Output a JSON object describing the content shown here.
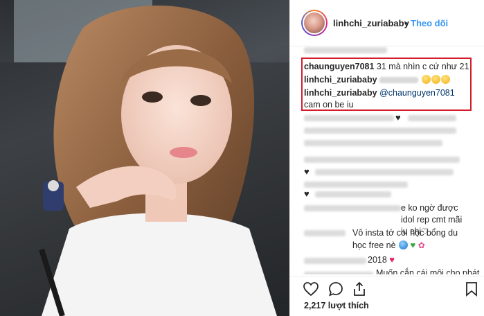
{
  "post": {
    "username": "linhchi_zuriababy",
    "separator": "•",
    "follow_label": "Theo dõi",
    "likes": "2,217 lượt thích"
  },
  "comments": {
    "c1_user": "chaunguyen7081",
    "c1_text": "31 mà nhìn c cứ như 21",
    "c2_user": "linhchi_zuriababy",
    "c3_user": "linhchi_zuriababy",
    "c3_mention": "@chaunguyen7081",
    "c3_text": "cam on be iu",
    "c4_text": "e ko ngờ được idol rep cmt mãi iu chị♡",
    "c5_text": "Vô insta tớ coi học bổng du học free nè",
    "c6_text": "2018",
    "c7_text": "Muốn cắn cái môi cho phát"
  },
  "icons": [
    "heart-icon",
    "comment-icon",
    "share-icon",
    "bookmark-icon",
    "avatar"
  ],
  "colors": {
    "follow": "#3897f0",
    "highlight_border": "#d41d2c",
    "text": "#262626"
  }
}
